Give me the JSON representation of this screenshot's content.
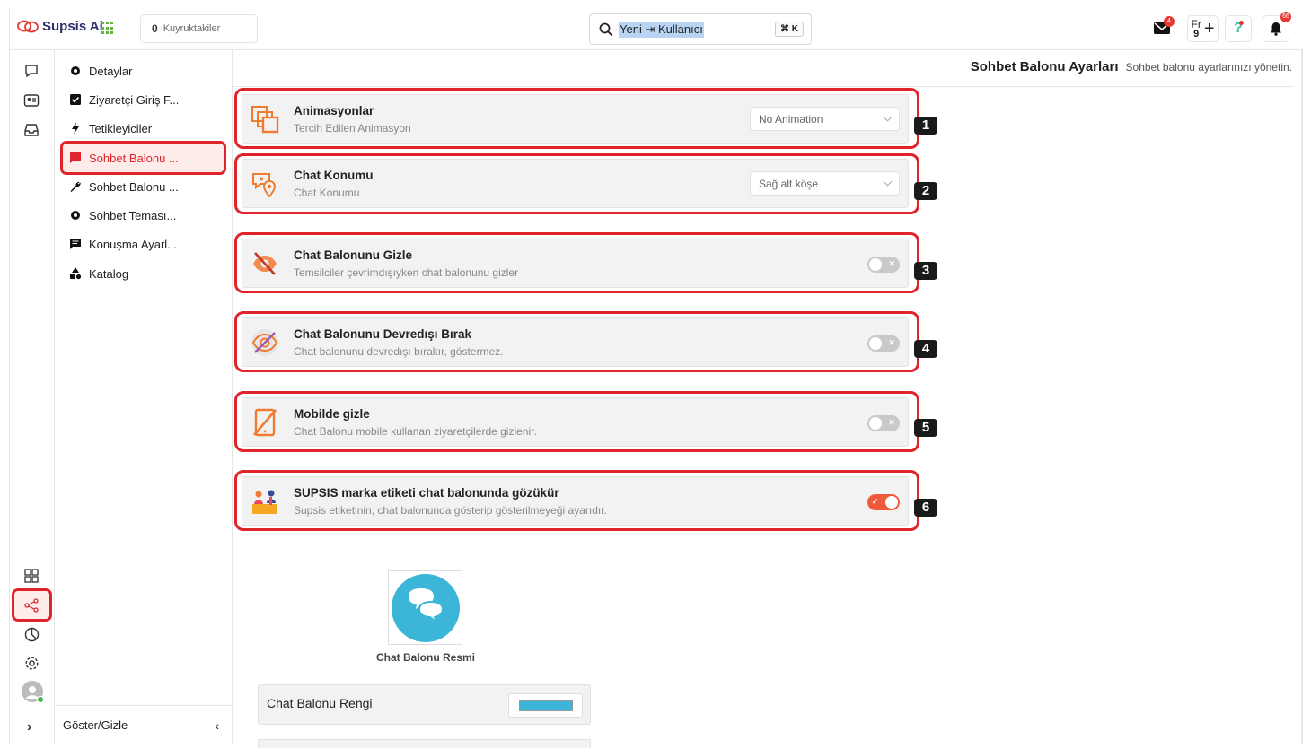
{
  "app": {
    "name": "Supsis Ai"
  },
  "topbar": {
    "queue_count": "0",
    "queue_label": "Kuyruktakiler",
    "search_text": "Yeni ⇥ Kullanıcı",
    "search_shortcut": "⌘ K",
    "mail_badge": "4",
    "lang_label": "Fr",
    "lang_sub": "9",
    "notif_badge": "66"
  },
  "subnav": {
    "items": [
      {
        "label": "Detaylar",
        "icon": "gear-icon"
      },
      {
        "label": "Ziyaretçi Giriş F...",
        "icon": "checkbox-icon"
      },
      {
        "label": "Tetikleyiciler",
        "icon": "bolt-icon"
      },
      {
        "label": "Sohbet Balonu ...",
        "icon": "chat-bubble-icon"
      },
      {
        "label": "Sohbet Balonu ...",
        "icon": "wrench-icon"
      },
      {
        "label": "Sohbet Teması...",
        "icon": "gear-icon"
      },
      {
        "label": "Konuşma Ayarl...",
        "icon": "message-icon"
      },
      {
        "label": "Katalog",
        "icon": "shapes-icon"
      }
    ],
    "active_index": 3,
    "footer_label": "Göster/Gizle"
  },
  "page": {
    "title": "Sohbet Balonu Ayarları",
    "subtitle": "Sohbet balonu ayarlarınızı yönetin."
  },
  "settings": [
    {
      "num": "1",
      "title": "Animasyonlar",
      "desc": "Tercih Edilen Animasyon",
      "control": "dropdown",
      "value": "No Animation",
      "icon": "animation-icon"
    },
    {
      "num": "2",
      "title": "Chat Konumu",
      "desc": "Chat Konumu",
      "control": "dropdown",
      "value": "Sağ alt köşe",
      "icon": "location-chat-icon"
    },
    {
      "num": "3",
      "title": "Chat Balonunu Gizle",
      "desc": "Temsilciler çevrimdışıyken chat balonunu gizler",
      "control": "toggle",
      "on": false,
      "icon": "hide-chat-icon"
    },
    {
      "num": "4",
      "title": "Chat Balonunu Devredışı Bırak",
      "desc": "Chat balonunu devredışı bırakır, göstermez.",
      "control": "toggle",
      "on": false,
      "icon": "eye-off-icon"
    },
    {
      "num": "5",
      "title": "Mobilde gizle",
      "desc": "Chat Balonu mobile kullanan ziyaretçilerde gizlenir.",
      "control": "toggle",
      "on": false,
      "icon": "mobile-off-icon"
    },
    {
      "num": "6",
      "title": "SUPSIS marka etiketi chat balonunda gözükür",
      "desc": "Supsis etiketinin, chat balonunda gösterip gösterilmeyeği ayarıdır.",
      "control": "toggle",
      "on": true,
      "icon": "brand-tag-icon"
    }
  ],
  "balloon": {
    "image_caption": "Chat Balonu Resmi",
    "color_label": "Chat Balonu Rengi",
    "color": "#3cb6d8"
  },
  "colors": {
    "accent": "#e0242c",
    "toggle_on": "#f05a3c",
    "icon_orange": "#f07a30"
  }
}
